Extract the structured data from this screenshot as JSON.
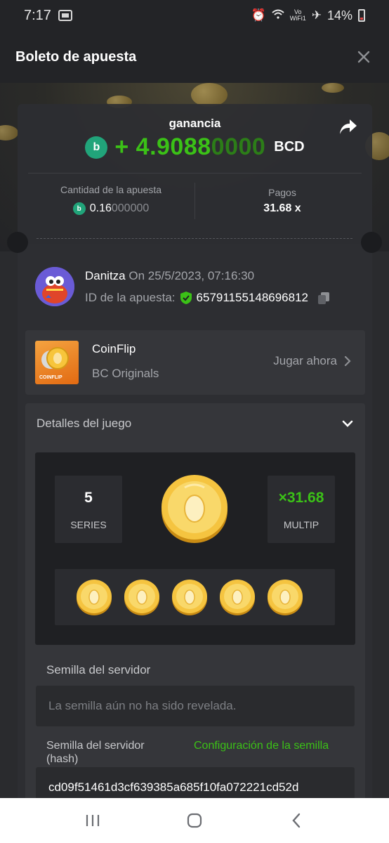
{
  "status_bar": {
    "time": "7:17",
    "battery": "14%",
    "vowifi_top": "Vo",
    "vowifi_bottom": "WiFi1"
  },
  "header": {
    "title": "Boleto de apuesta"
  },
  "ticket": {
    "gain_label": "ganancia",
    "gain_sign": "+",
    "gain_amount_main": "4.9088",
    "gain_amount_dim": "0000",
    "gain_currency": "BCD",
    "bet_amount_label": "Cantidad de la apuesta",
    "bet_amount_main": "0.16",
    "bet_amount_dim": "000000",
    "payout_label": "Pagos",
    "payout_value": "31.68 x"
  },
  "user": {
    "name": "Danitza",
    "date": "On 25/5/2023, 07:16:30",
    "bet_id_label": "ID de la apuesta:",
    "bet_id_value": "6579115514869681​2"
  },
  "game": {
    "name": "CoinFlip",
    "provider": "BC Originals",
    "play_now": "Jugar ahora",
    "thumb_label": "COINFLIP"
  },
  "details": {
    "title": "Detalles del juego",
    "series_value": "5",
    "series_label": "SERIES",
    "multiplier_value": "×31.68",
    "multiplier_label": "MULTIP",
    "server_seed_label": "Semilla del servidor",
    "server_seed_placeholder": "La semilla aún no ha sido revelada.",
    "server_seed_hash_label": "Semilla del servidor (hash)",
    "seed_config_link": "Configuración de la semilla",
    "server_seed_hash": "cd09f51461d3cf639385a685f10fa072221cd52d"
  },
  "colors": {
    "accent_green": "#3bc117",
    "bc_green": "#21a47a",
    "background": "#2a2b2e"
  }
}
